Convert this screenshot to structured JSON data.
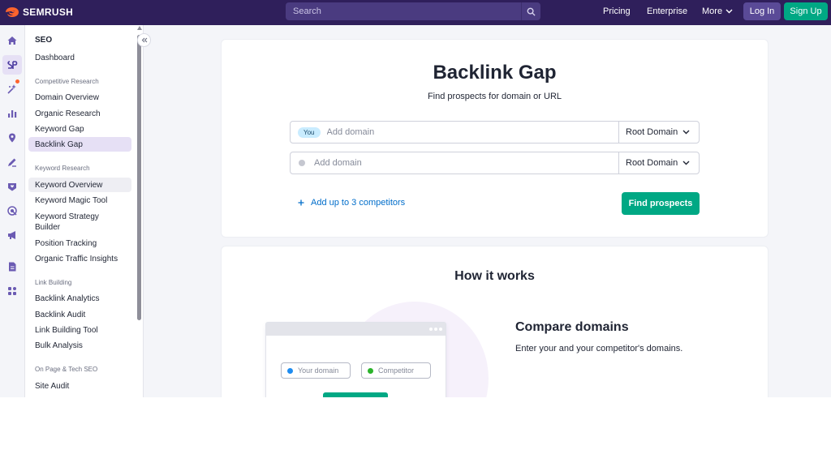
{
  "topbar": {
    "logo_text": "SEMRUSH",
    "search_placeholder": "Search",
    "nav": [
      "Pricing",
      "Enterprise",
      "More"
    ],
    "login_label": "Log In",
    "signup_label": "Sign Up"
  },
  "colors": {
    "topbar_bg": "#2f1f5b",
    "accent_green": "#00a884",
    "active_purple": "#e6e0f5",
    "link_blue": "#006dca",
    "notification_orange": "#ff642d"
  },
  "rail": {
    "icons": [
      "home-icon",
      "seo-icon",
      "ai-sparkle-icon",
      "bar-chart-icon",
      "location-pin-icon",
      "pen-icon",
      "heart-shield-icon",
      "target-icon",
      "megaphone-icon",
      "document-icon",
      "apps-grid-icon"
    ],
    "active_index": 1
  },
  "sidebar": {
    "section_title": "SEO",
    "dashboard": "Dashboard",
    "groups": [
      {
        "label": "Competitive Research",
        "items": [
          "Domain Overview",
          "Organic Research",
          "Keyword Gap",
          "Backlink Gap"
        ]
      },
      {
        "label": "Keyword Research",
        "items": [
          "Keyword Overview",
          "Keyword Magic Tool",
          "Keyword Strategy Builder",
          "Position Tracking",
          "Organic Traffic Insights"
        ]
      },
      {
        "label": "Link Building",
        "items": [
          "Backlink Analytics",
          "Backlink Audit",
          "Link Building Tool",
          "Bulk Analysis"
        ]
      },
      {
        "label": "On Page & Tech SEO",
        "items": [
          "Site Audit"
        ]
      }
    ],
    "active_item": "Backlink Gap",
    "hover_item": "Keyword Overview"
  },
  "main": {
    "title": "Backlink Gap",
    "subtitle": "Find prospects for domain or URL",
    "you_badge": "You",
    "domain_placeholder": "Add domain",
    "root_domain_label": "Root Domain",
    "add_competitors": "Add up to 3 competitors",
    "find_button": "Find prospects"
  },
  "how_it_works": {
    "title": "How it works",
    "step_title": "Compare domains",
    "step_text": "Enter your and your competitor's domains.",
    "illus_your_domain": "Your domain",
    "illus_competitor": "Competitor"
  }
}
